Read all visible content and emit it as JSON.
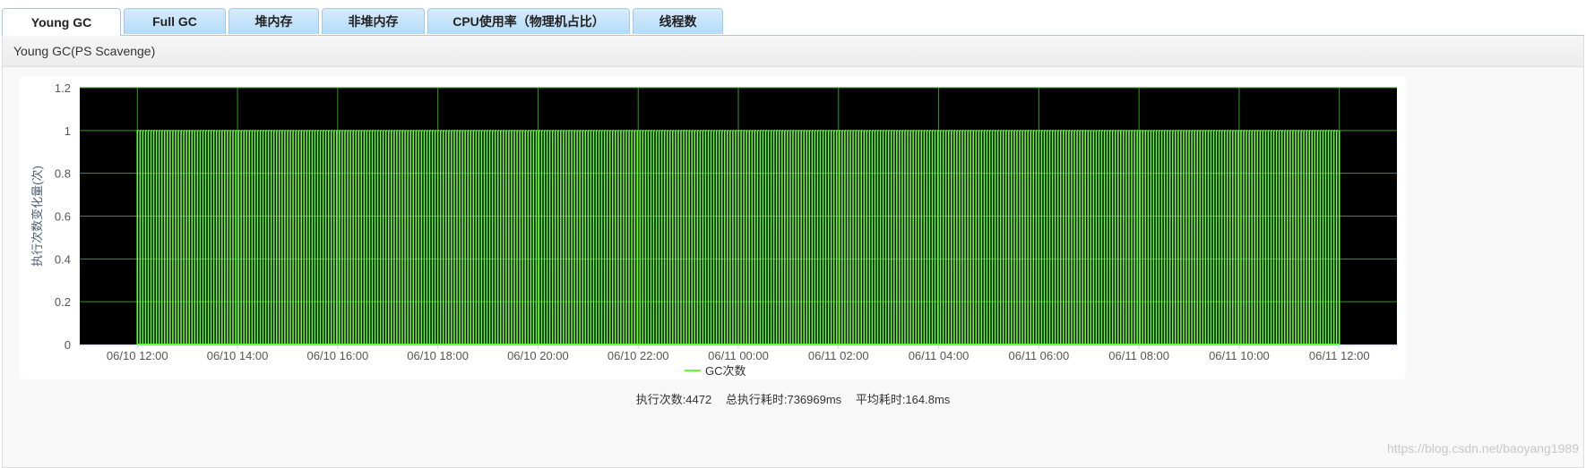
{
  "tabs": [
    {
      "label": "Young GC",
      "active": true
    },
    {
      "label": "Full GC"
    },
    {
      "label": "堆内存"
    },
    {
      "label": "非堆内存"
    },
    {
      "label": "CPU使用率（物理机占比）"
    },
    {
      "label": "线程数"
    }
  ],
  "panel": {
    "title": "Young GC(PS Scavenge)"
  },
  "footer": {
    "count": "执行次数:4472",
    "total": "总执行耗时:736969ms",
    "avg": "平均耗时:164.8ms"
  },
  "watermark": "https://blog.csdn.net/baoyang1989",
  "colors": {
    "series": "#66ff33",
    "plot_bg": "#000000",
    "grid": "#3a9a20"
  },
  "chart_data": {
    "type": "line",
    "title": "",
    "ylabel": "执行次数变化量(次)",
    "xlabel": "",
    "ylim": [
      0,
      1.2
    ],
    "yticks": [
      "0",
      "0.2",
      "0.4",
      "0.6",
      "0.8",
      "1",
      "1.2"
    ],
    "xlim_hours": [
      -1.15,
      25.15
    ],
    "xticks": [
      "06/10 12:00",
      "06/10 14:00",
      "06/10 16:00",
      "06/10 18:00",
      "06/10 20:00",
      "06/10 22:00",
      "06/11 00:00",
      "06/11 02:00",
      "06/11 04:00",
      "06/11 06:00",
      "06/11 08:00",
      "06/11 10:00",
      "06/11 12:00"
    ],
    "legend": {
      "entries": [
        "GC次数"
      ],
      "position": "bottom-center"
    },
    "series": [
      {
        "name": "GC次数",
        "start": "06/10 12:00",
        "end": "06/11 12:00",
        "pattern": [
          0,
          1
        ],
        "spike_count": 440,
        "value_range": [
          0,
          1
        ]
      }
    ]
  }
}
